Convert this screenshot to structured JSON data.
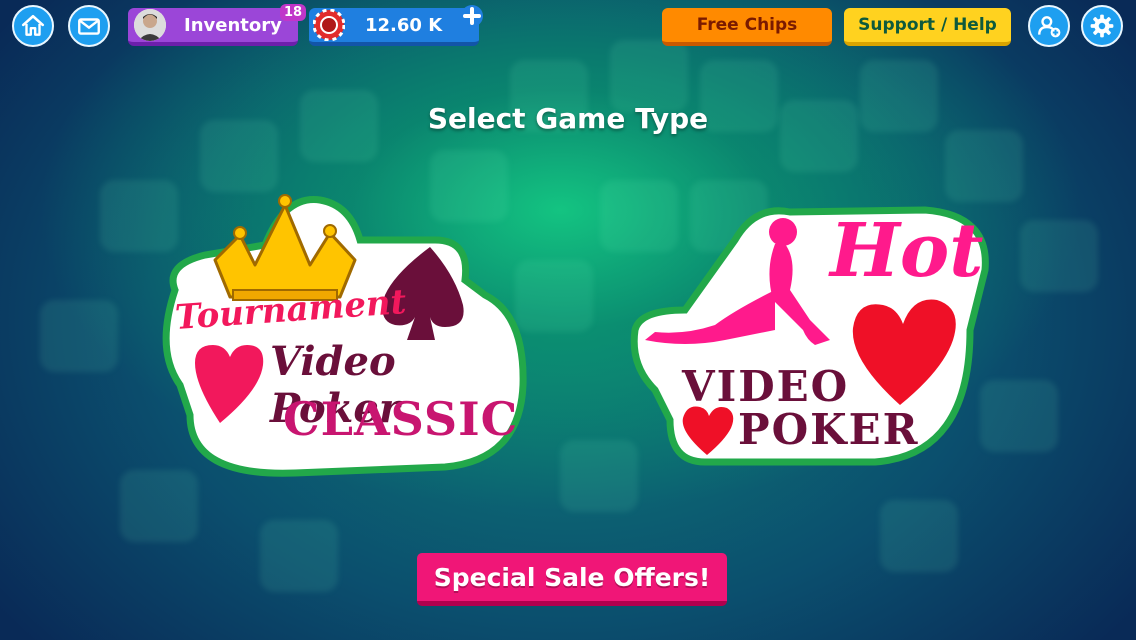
{
  "topbar": {
    "inventory_label": "Inventory",
    "inventory_badge": "18",
    "chips_amount": "12.60 K",
    "free_chips_label": "Free Chips",
    "support_label": "Support / Help"
  },
  "main": {
    "title": "Select Game Type",
    "games": [
      {
        "line1": "Tournament",
        "line2": "Video Poker",
        "line3": "CLASSIC"
      },
      {
        "line1": "Hot",
        "line2": "VIDEO",
        "line3": "POKER"
      }
    ],
    "sale_button_label": "Special Sale Offers!"
  },
  "colors": {
    "accent_blue": "#1e9ff0",
    "inventory_purple": "#9b46d8",
    "free_chips_orange": "#ff8a00",
    "support_yellow": "#ffd21f",
    "sale_pink": "#f01677",
    "logo_maroon": "#6a0f3a",
    "logo_pink": "#ff1a8c",
    "logo_green_outline": "#1aa64a"
  },
  "icons": [
    "home-icon",
    "mail-icon",
    "avatar-icon",
    "poker-chip-icon",
    "plus-icon",
    "add-friend-icon",
    "gear-icon",
    "crown-icon",
    "spade-icon",
    "heart-icon",
    "woman-silhouette-icon"
  ]
}
